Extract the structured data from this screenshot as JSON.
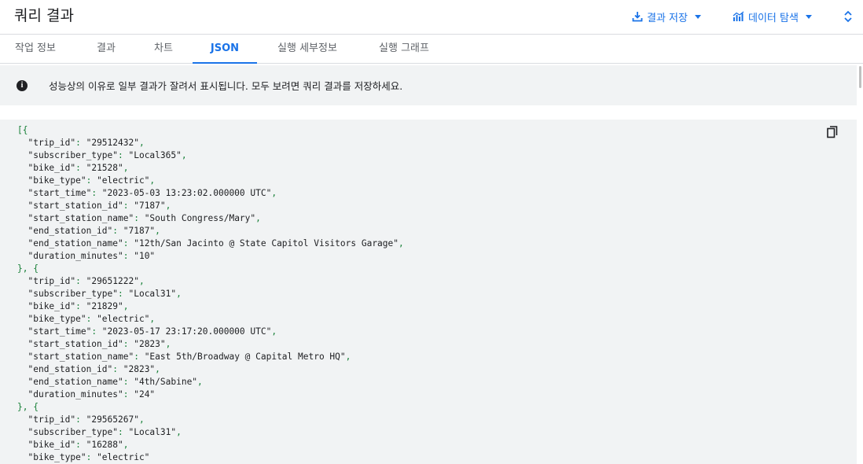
{
  "header": {
    "title": "쿼리 결과",
    "save_label": "결과 저장",
    "explore_label": "데이터 탐색"
  },
  "tabs": [
    {
      "label": "작업 정보"
    },
    {
      "label": "결과"
    },
    {
      "label": "차트"
    },
    {
      "label": "JSON",
      "active": true
    },
    {
      "label": "실행 세부정보"
    },
    {
      "label": "실행 그래프"
    }
  ],
  "info": {
    "message": "성능상의 이유로 일부 결과가 잘려서 표시됩니다. 모두 보려면 쿼리 결과를 저장하세요."
  },
  "colors": {
    "accent": "#1a73e8",
    "json_punctuation": "#188038"
  },
  "icons": [
    "download-icon",
    "chart-icon",
    "expand-collapse-icon",
    "info-icon",
    "copy-icon"
  ],
  "json_records": [
    [
      [
        "trip_id",
        "29512432"
      ],
      [
        "subscriber_type",
        "Local365"
      ],
      [
        "bike_id",
        "21528"
      ],
      [
        "bike_type",
        "electric"
      ],
      [
        "start_time",
        "2023-05-03 13:23:02.000000 UTC"
      ],
      [
        "start_station_id",
        "7187"
      ],
      [
        "start_station_name",
        "South Congress/Mary"
      ],
      [
        "end_station_id",
        "7187"
      ],
      [
        "end_station_name",
        "12th/San Jacinto @ State Capitol Visitors Garage"
      ],
      [
        "duration_minutes",
        "10"
      ]
    ],
    [
      [
        "trip_id",
        "29651222"
      ],
      [
        "subscriber_type",
        "Local31"
      ],
      [
        "bike_id",
        "21829"
      ],
      [
        "bike_type",
        "electric"
      ],
      [
        "start_time",
        "2023-05-17 23:17:20.000000 UTC"
      ],
      [
        "start_station_id",
        "2823"
      ],
      [
        "start_station_name",
        "East 5th/Broadway @ Capital Metro HQ"
      ],
      [
        "end_station_id",
        "2823"
      ],
      [
        "end_station_name",
        "4th/Sabine"
      ],
      [
        "duration_minutes",
        "24"
      ]
    ],
    [
      [
        "trip_id",
        "29565267"
      ],
      [
        "subscriber_type",
        "Local31"
      ],
      [
        "bike_id",
        "16288"
      ],
      [
        "bike_type",
        "electric"
      ]
    ]
  ]
}
